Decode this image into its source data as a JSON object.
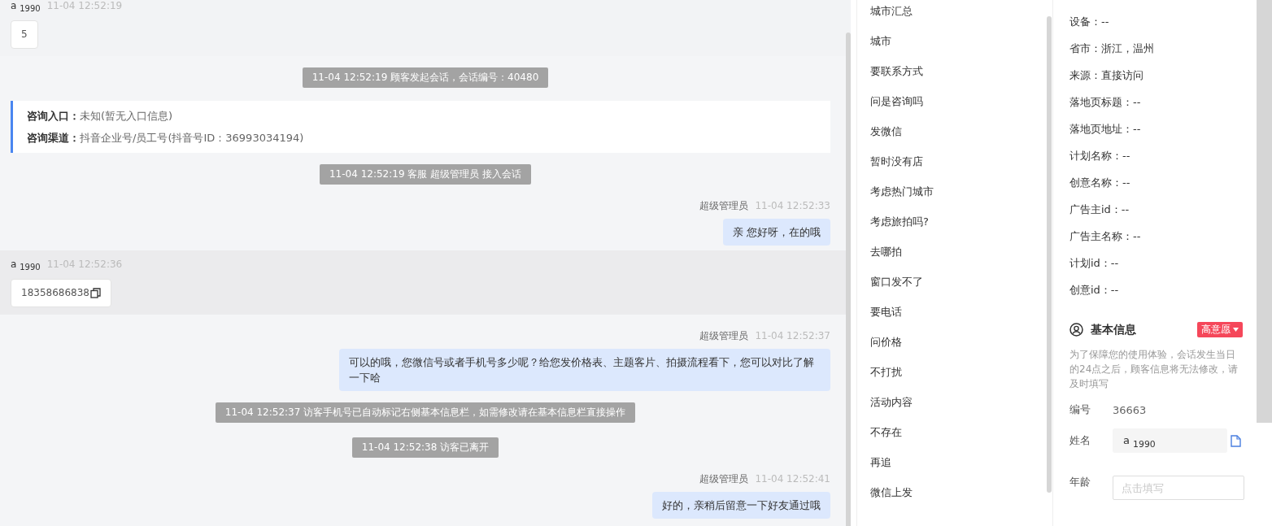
{
  "messages": [
    {
      "kind": "visitor",
      "name": "a $_{1990}$",
      "time": "11-04 12:52:19",
      "text": "5",
      "highlighted": false,
      "copyable": false
    },
    {
      "kind": "system",
      "text": "11-04 12:52:19 顾客发起会话，会话编号：40480"
    },
    {
      "kind": "info",
      "rows": [
        {
          "label": "咨询入口：",
          "value": "未知(暂无入口信息)"
        },
        {
          "label": "咨询渠道：",
          "value": "抖音企业号/员工号(抖音号ID：36993034194)"
        }
      ]
    },
    {
      "kind": "system",
      "text": "11-04 12:52:19 客服 超级管理员 接入会话"
    },
    {
      "kind": "agent",
      "name": "超级管理员",
      "time": "11-04 12:52:33",
      "text": "亲 您好呀，在的哦"
    },
    {
      "kind": "visitor",
      "name": "a $_{1990}$",
      "time": "11-04 12:52:36",
      "text": "18358686838",
      "highlighted": true,
      "copyable": true
    },
    {
      "kind": "agent",
      "name": "超级管理员",
      "time": "11-04 12:52:37",
      "text": "可以的哦，您微信号或者手机号多少呢？给您发价格表、主题客片、拍摄流程看下，您可以对比了解一下哈"
    },
    {
      "kind": "system",
      "text": "11-04 12:52:37 访客手机号已自动标记右侧基本信息栏，如需修改请在基本信息栏直接操作"
    },
    {
      "kind": "system",
      "text": "11-04 12:52:38 访客已离开"
    },
    {
      "kind": "agent",
      "name": "超级管理员",
      "time": "11-04 12:52:41",
      "text": "好的，亲稍后留意一下好友通过哦"
    }
  ],
  "quick_replies": [
    "城市汇总",
    "城市",
    "要联系方式",
    "问是咨询吗",
    "发微信",
    "暂时没有店",
    "考虑热门城市",
    "考虑旅拍吗?",
    "去哪拍",
    "窗口发不了",
    "要电话",
    "问价格",
    "不打扰",
    "活动内容",
    "不存在",
    "再追",
    "微信上发"
  ],
  "visitor_details": [
    "设备：--",
    "省市：浙江，温州",
    "来源：直接访问",
    "落地页标题：--",
    "落地页地址：--",
    "计划名称：--",
    "创意名称：--",
    "广告主id：--",
    "广告主名称：--",
    "计划id：--",
    "创意id：--"
  ],
  "basic_info": {
    "title": "基本信息",
    "intent_tag": "高意愿",
    "notice": "为了保障您的使用体验，会话发生当日的24点之后，顾客信息将无法修改，请及时填写",
    "fields": [
      {
        "kind": "text",
        "label": "编号",
        "value": "36663"
      },
      {
        "kind": "filled",
        "label": "姓名",
        "value": "a $_{1990}$"
      },
      {
        "kind": "input",
        "label": "年龄",
        "placeholder": "点击填写"
      }
    ]
  }
}
